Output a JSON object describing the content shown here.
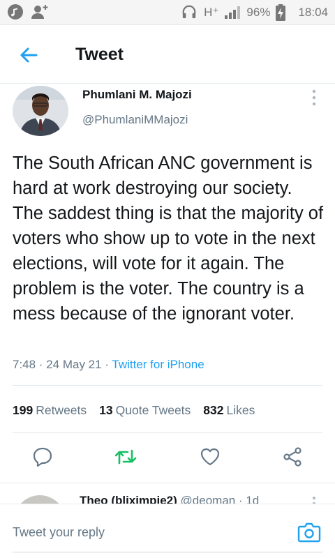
{
  "statusbar": {
    "network": "H⁺",
    "battery": "96%",
    "time": "18:04"
  },
  "appbar": {
    "title": "Tweet"
  },
  "tweet": {
    "author_name": "Phumlani M. Majozi",
    "author_handle": "@PhumlaniMMajozi",
    "text": "The South African ANC government is hard at work destroying our society. The saddest thing is that the majority of voters who show up to vote in the next elections, will vote for it again. The problem is the voter. The country is a mess because of the ignorant voter.",
    "timestamp": "7:48 · 24 May 21 · ",
    "source": "Twitter for iPhone",
    "stats": {
      "retweets_count": "199",
      "retweets_label": "Retweets",
      "quotes_count": "13",
      "quotes_label": "Quote Tweets",
      "likes_count": "832",
      "likes_label": "Likes"
    }
  },
  "reply_preview": {
    "name": "Theo (bliximpie2)",
    "meta": "@deoman · 1d"
  },
  "composer": {
    "placeholder": "Tweet your reply"
  },
  "colors": {
    "accent": "#1da1f2",
    "retweet": "#17bf63",
    "muted": "#657786"
  }
}
